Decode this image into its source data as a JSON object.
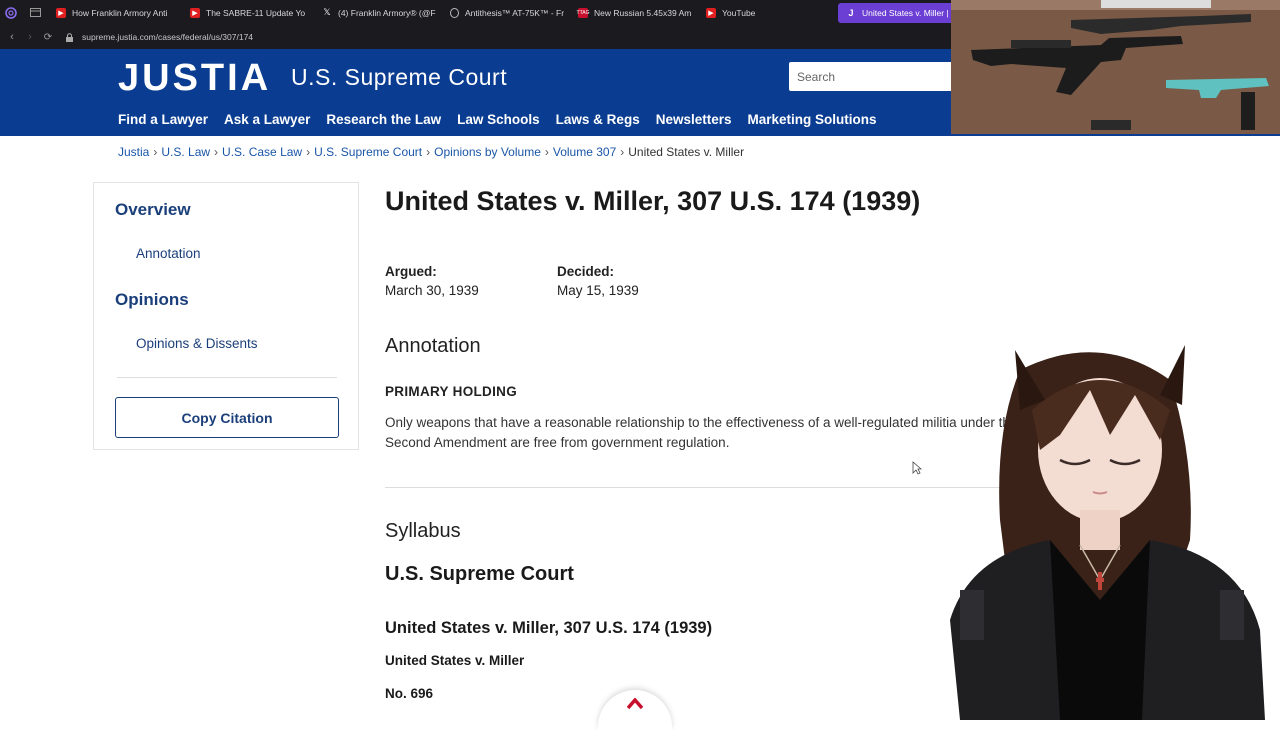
{
  "browser": {
    "tabs": [
      {
        "label": "How Franklin Armory Anti",
        "icon": "youtube-icon"
      },
      {
        "label": "The SABRE-11 Update Yo",
        "icon": "youtube-icon"
      },
      {
        "label": "(4) Franklin Armory® (@F",
        "icon": "x-icon"
      },
      {
        "label": "Antithesis™ AT-75K™ - Fr",
        "icon": "franklin-icon"
      },
      {
        "label": "New Russian 5.45x39 Am",
        "icon": "ttag-icon"
      },
      {
        "label": "YouTube",
        "icon": "youtube-icon"
      },
      {
        "label": "United States v. Miller | 30",
        "icon": "justia-icon"
      }
    ],
    "new_tab": "+",
    "url": "supreme.justia.com/cases/federal/us/307/174"
  },
  "header": {
    "logo": "JUSTIA",
    "subtitle": "U.S. Supreme Court",
    "search_placeholder": "Search",
    "nav": [
      "Find a Lawyer",
      "Ask a Lawyer",
      "Research the Law",
      "Law Schools",
      "Laws & Regs",
      "Newsletters",
      "Marketing Solutions"
    ]
  },
  "breadcrumb": {
    "items": [
      "Justia",
      "U.S. Law",
      "U.S. Case Law",
      "U.S. Supreme Court",
      "Opinions by Volume",
      "Volume 307"
    ],
    "current": "United States v. Miller",
    "separator": "›"
  },
  "sidebar": {
    "overview": "Overview",
    "annotation": "Annotation",
    "opinions": "Opinions",
    "opinions_dissents": "Opinions & Dissents",
    "copy_citation": "Copy Citation"
  },
  "main": {
    "title": "United States v. Miller, 307 U.S. 174 (1939)",
    "argued_label": "Argued:",
    "argued_date": "March 30, 1939",
    "decided_label": "Decided:",
    "decided_date": "May 15, 1939",
    "annotation_heading": "Annotation",
    "primary_holding_label": "PRIMARY HOLDING",
    "holding_text": "Only weapons that have a reasonable relationship to the effectiveness of a well-regulated militia under the Second Amendment are free from government regulation.",
    "syllabus_heading": "Syllabus",
    "court_heading": "U.S. Supreme Court",
    "case_heading": "United States v. Miller, 307 U.S. 174 (1939)",
    "case_name": "United States v. Miller",
    "docket": "No. 696"
  },
  "colors": {
    "justia_blue": "#0a3d91",
    "link_blue": "#1b3f7a",
    "tab_active": "#6b3fd4",
    "browser_chrome": "#1b1b1f"
  }
}
